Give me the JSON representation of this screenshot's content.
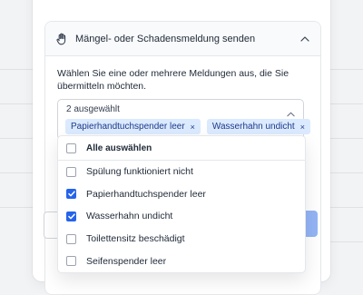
{
  "panel": {
    "title": "Mängel- oder Schadensmeldung senden",
    "description": "Wählen Sie eine oder mehrere Meldungen aus, die Sie übermitteln möchten.",
    "icon": "hand-icon"
  },
  "select": {
    "selected_count_label": "2 ausgewählt",
    "chips": [
      {
        "label": "Papierhandtuchspender leer",
        "remove": "×"
      },
      {
        "label": "Wasserhahn undicht",
        "remove": "×"
      }
    ]
  },
  "dropdown": {
    "select_all_label": "Alle auswählen",
    "options": [
      {
        "label": "Spülung funktioniert nicht",
        "checked": false
      },
      {
        "label": "Papierhandtuchspender leer",
        "checked": true
      },
      {
        "label": "Wasserhahn undicht",
        "checked": true
      },
      {
        "label": "Toilettensitz beschädigt",
        "checked": false
      },
      {
        "label": "Seifenspender leer",
        "checked": false
      }
    ]
  },
  "colors": {
    "accent": "#2563eb",
    "chip_bg": "#dbeafe",
    "button_disabled": "#93b4f5"
  }
}
